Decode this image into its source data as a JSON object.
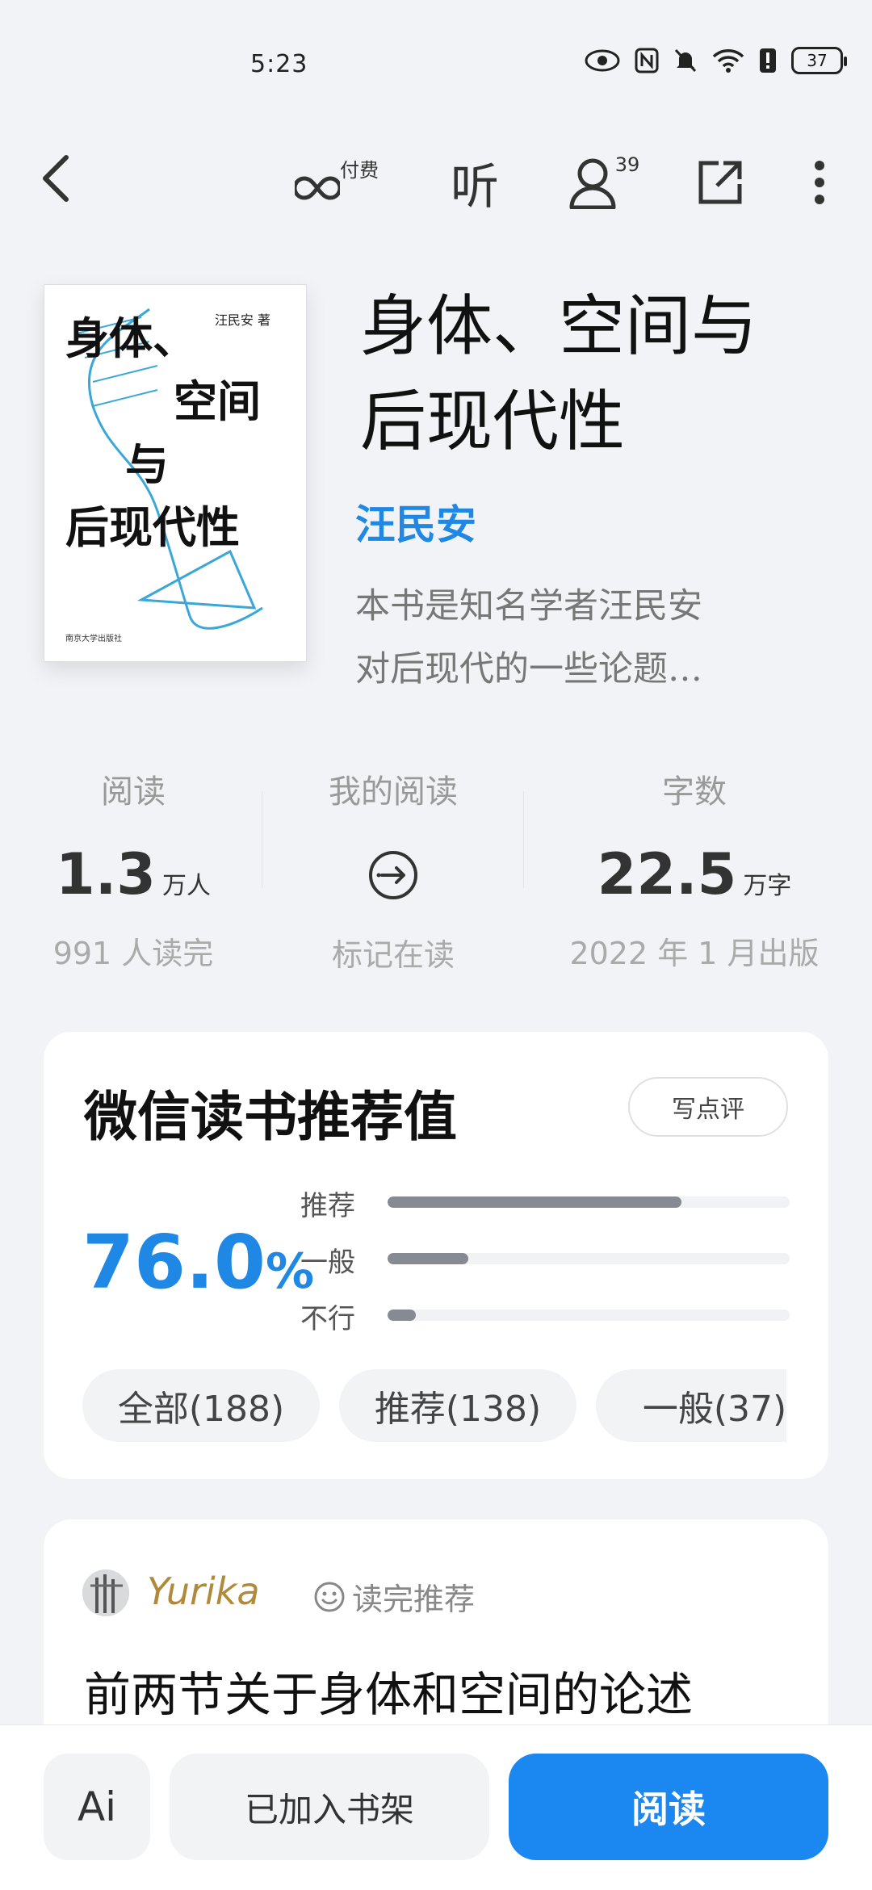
{
  "status_bar": {
    "time": "5:23",
    "battery": "37"
  },
  "toolbar": {
    "paid_label": "付费",
    "listen_label": "听",
    "readers_count": "39"
  },
  "book": {
    "cover": {
      "author": "汪民安  著",
      "title_lines": [
        "身体、",
        "空间",
        "与",
        "后现代性"
      ],
      "publisher": "南京大学出版社"
    },
    "title_line1": "身体、空间与",
    "title_line2": "后现代性",
    "author": "汪民安",
    "desc_line1": "本书是知名学者汪民安",
    "desc_line2": "对后现代的一些论题…"
  },
  "stats": {
    "reads": {
      "label": "阅读",
      "value": "1.3",
      "unit": "万人",
      "sub": "991 人读完"
    },
    "my_reading": {
      "label": "我的阅读",
      "sub": "标记在读"
    },
    "words": {
      "label": "字数",
      "value": "22.5",
      "unit": "万字",
      "sub": "2022 年 1 月出版"
    }
  },
  "rating": {
    "title": "微信读书推荐值",
    "write_label": "写点评",
    "percent": "76.0",
    "percent_sign": "%",
    "bars": [
      {
        "label": "推荐",
        "fraction": 0.73
      },
      {
        "label": "一般",
        "fraction": 0.2
      },
      {
        "label": "不行",
        "fraction": 0.07
      }
    ],
    "chips": [
      "全部(188)",
      "推荐(138)",
      "一般(37)"
    ]
  },
  "review": {
    "user": "Yurika",
    "tag": "读完推荐",
    "text": "前两节关于身体和空间的论述"
  },
  "bottom": {
    "ai_label": "Ai",
    "shelf_label": "已加入书架",
    "read_label": "阅读"
  },
  "colors": {
    "accent": "#1b87f1",
    "author_blue": "#1f88e5",
    "reviewer_gold": "#b08a3a"
  }
}
